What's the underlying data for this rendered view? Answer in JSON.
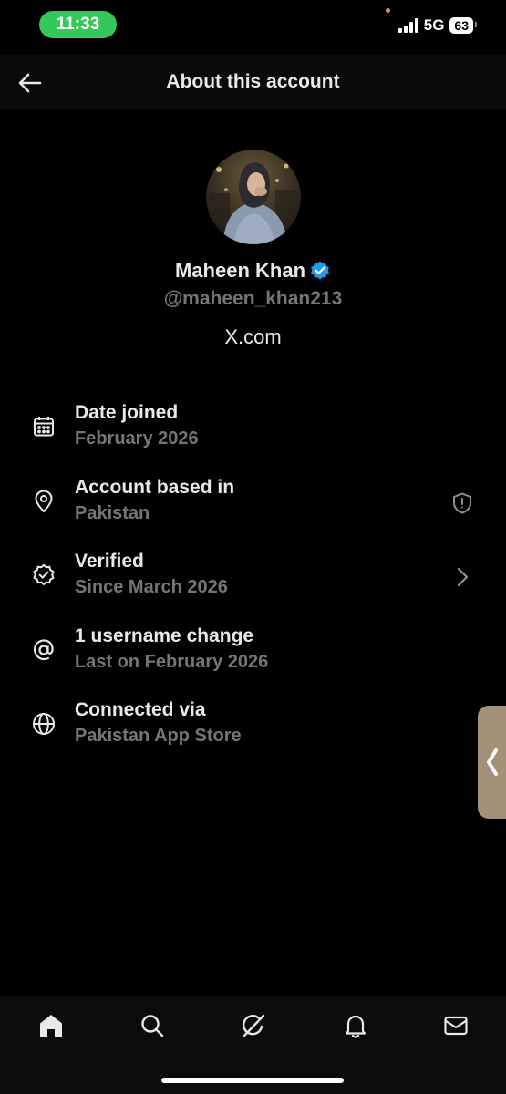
{
  "status_bar": {
    "time": "11:33",
    "network": "5G",
    "battery": "63"
  },
  "header": {
    "title": "About this account",
    "back_icon": "arrow-left-icon"
  },
  "profile": {
    "name": "Maheen Khan",
    "handle": "@maheen_khan213",
    "site": "X.com",
    "verified_badge_color": "#1d9bf0"
  },
  "info_rows": [
    {
      "icon": "calendar-icon",
      "title": "Date joined",
      "subtitle": "February 2026"
    },
    {
      "icon": "location-pin-icon",
      "title": "Account based in",
      "subtitle": "Pakistan",
      "trailing": "shield-alert-icon"
    },
    {
      "icon": "verified-badge-icon",
      "title": "Verified",
      "subtitle": "Since March 2026",
      "trailing": "chevron-right-icon"
    },
    {
      "icon": "at-sign-icon",
      "title": "1 username change",
      "subtitle": "Last on February 2026"
    },
    {
      "icon": "globe-icon",
      "title": "Connected via",
      "subtitle": "Pakistan App Store"
    }
  ],
  "bottom_nav": [
    "home-icon",
    "search-icon",
    "grok-icon",
    "bell-icon",
    "mail-icon"
  ],
  "colors": {
    "background": "#000000",
    "text_primary": "#e7e9ea",
    "text_secondary": "#71767b",
    "status_pill": "#34c759",
    "verified_blue": "#1d9bf0"
  }
}
